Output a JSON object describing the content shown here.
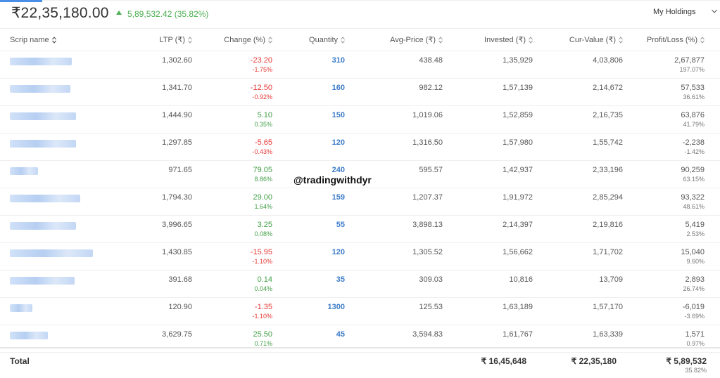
{
  "header": {
    "total_value": "₹22,35,180.00",
    "pnl_summary": "5,89,532.42 (35.82%)",
    "view_select": "My Holdings"
  },
  "columns": [
    "Scrip name",
    "LTP (₹)",
    "Change (%)",
    "Quantity",
    "Avg-Price (₹)",
    "Invested (₹)",
    "Cur-Value (₹)",
    "Profit/Loss (%)"
  ],
  "rows": [
    {
      "ltp": "1,302.60",
      "change": "-23.20",
      "change_pct": "-1.75%",
      "qty": "310",
      "avg": "438.48",
      "invested": "1,35,929",
      "cur": "4,03,806",
      "pl": "2,67,877",
      "pl_pct": "197.07%",
      "trend": "neg"
    },
    {
      "ltp": "1,341.70",
      "change": "-12.50",
      "change_pct": "-0.92%",
      "qty": "160",
      "avg": "982.12",
      "invested": "1,57,139",
      "cur": "2,14,672",
      "pl": "57,533",
      "pl_pct": "36.61%",
      "trend": "neg"
    },
    {
      "ltp": "1,444.90",
      "change": "5.10",
      "change_pct": "0.35%",
      "qty": "150",
      "avg": "1,019.06",
      "invested": "1,52,859",
      "cur": "2,16,735",
      "pl": "63,876",
      "pl_pct": "41.79%",
      "trend": "pos"
    },
    {
      "ltp": "1,297.85",
      "change": "-5.65",
      "change_pct": "-0.43%",
      "qty": "120",
      "avg": "1,316.50",
      "invested": "1,57,980",
      "cur": "1,55,742",
      "pl": "-2,238",
      "pl_pct": "-1.42%",
      "trend": "neg"
    },
    {
      "ltp": "971.65",
      "change": "79.05",
      "change_pct": "8.86%",
      "qty": "240",
      "avg": "595.57",
      "invested": "1,42,937",
      "cur": "2,33,196",
      "pl": "90,259",
      "pl_pct": "63.15%",
      "trend": "pos"
    },
    {
      "ltp": "1,794.30",
      "change": "29.00",
      "change_pct": "1.64%",
      "qty": "159",
      "avg": "1,207.37",
      "invested": "1,91,972",
      "cur": "2,85,294",
      "pl": "93,322",
      "pl_pct": "48.61%",
      "trend": "pos"
    },
    {
      "ltp": "3,996.65",
      "change": "3.25",
      "change_pct": "0.08%",
      "qty": "55",
      "avg": "3,898.13",
      "invested": "2,14,397",
      "cur": "2,19,816",
      "pl": "5,419",
      "pl_pct": "2.53%",
      "trend": "pos"
    },
    {
      "ltp": "1,430.85",
      "change": "-15.95",
      "change_pct": "-1.10%",
      "qty": "120",
      "avg": "1,305.52",
      "invested": "1,56,662",
      "cur": "1,71,702",
      "pl": "15,040",
      "pl_pct": "9.60%",
      "trend": "neg"
    },
    {
      "ltp": "391.68",
      "change": "0.14",
      "change_pct": "0.04%",
      "qty": "35",
      "avg": "309.03",
      "invested": "10,816",
      "cur": "13,709",
      "pl": "2,893",
      "pl_pct": "26.74%",
      "trend": "pos"
    },
    {
      "ltp": "120.90",
      "change": "-1.35",
      "change_pct": "-1.10%",
      "qty": "1300",
      "avg": "125.53",
      "invested": "1,63,189",
      "cur": "1,57,170",
      "pl": "-6,019",
      "pl_pct": "-3.69%",
      "trend": "neg"
    },
    {
      "ltp": "3,629.75",
      "change": "25.50",
      "change_pct": "0.71%",
      "qty": "45",
      "avg": "3,594.83",
      "invested": "1,61,767",
      "cur": "1,63,339",
      "pl": "1,571",
      "pl_pct": "0.97%",
      "trend": "pos"
    }
  ],
  "watermark": "@tradingwithdyr",
  "total": {
    "label": "Total",
    "invested": "₹ 16,45,648",
    "cur": "₹ 22,35,180",
    "pl": "₹ 5,89,532",
    "pl_pct": "35.82%"
  },
  "colors": {
    "positive": "#43a047",
    "negative": "#e53935",
    "quantity": "#3d7cc9",
    "accent": "#4a8fe7"
  },
  "icons": {
    "sort": "sort-icon",
    "dropdown": "chevron-down-icon"
  }
}
